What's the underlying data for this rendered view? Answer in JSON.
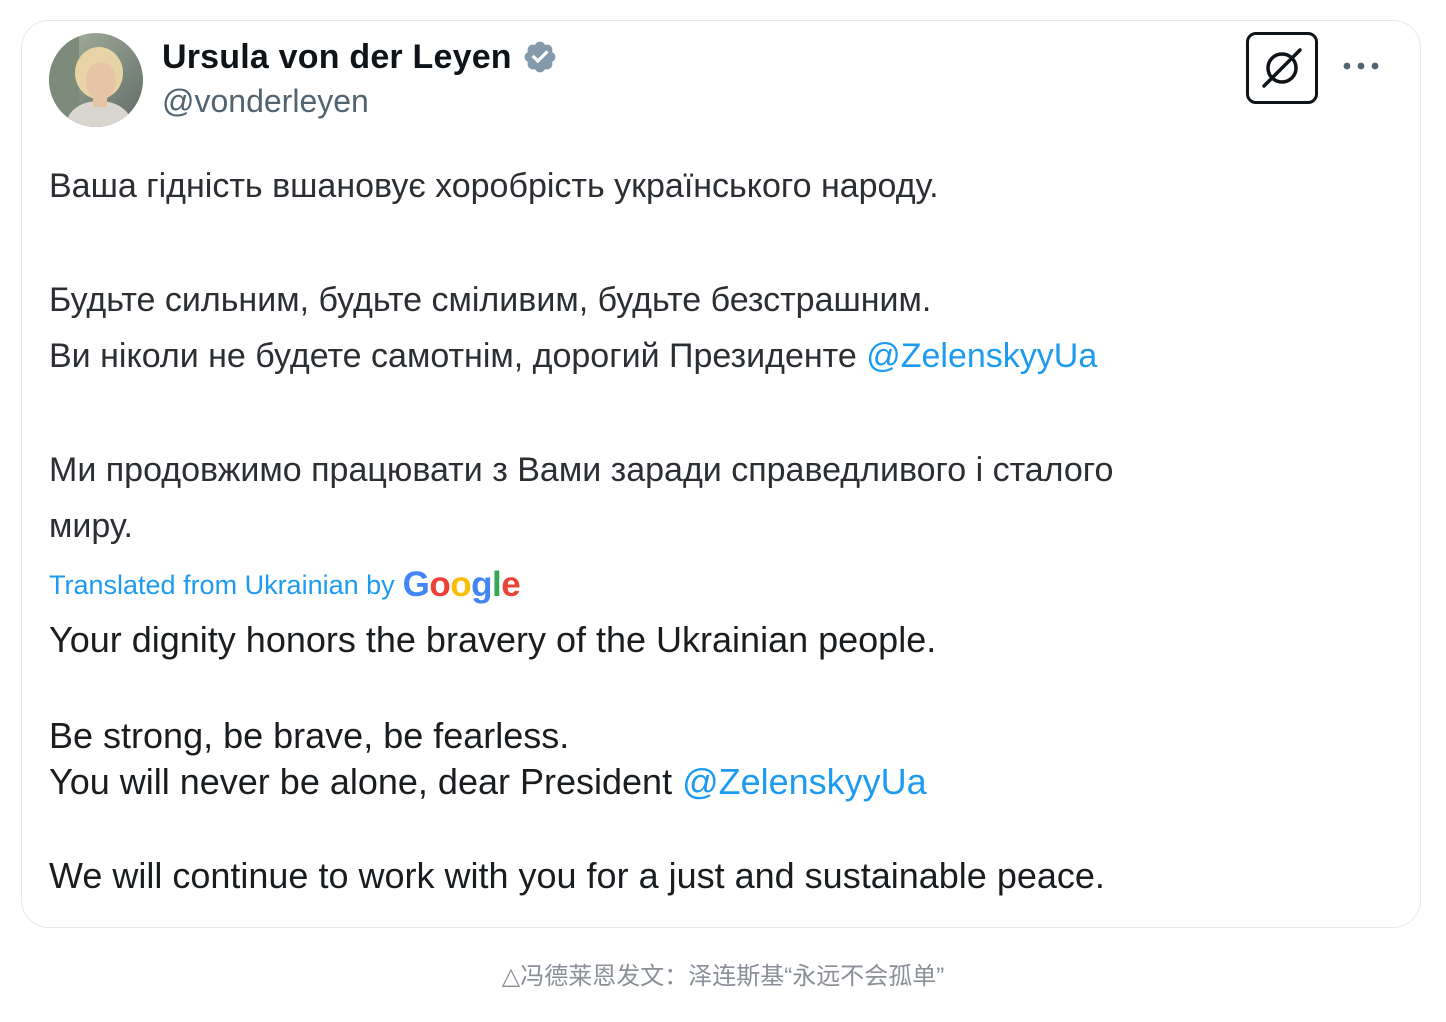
{
  "tweet": {
    "author_name": "Ursula von der Leyen",
    "author_handle": "@vonderleyen",
    "verified_icon": "verified-badge-icon",
    "grok_icon": "grok-icon",
    "more_icon": "more-dots-icon",
    "original": {
      "line1": "Ваша гідність вшановує хоробрість українського народу.",
      "line2": "Будьте сильним, будьте сміливим, будьте безстрашним.",
      "line3_text": "Ви ніколи не будете самотнім, дорогий Президенте ",
      "line3_mention": "@ZelenskyyUa",
      "line4": "Ми продовжимо працювати з Вами заради справедливого і сталого",
      "line5": "миру."
    },
    "translation_label": "Translated from Ukrainian by",
    "translation_provider": "Google",
    "translated": {
      "line1": "Your dignity honors the bravery of the Ukrainian people.",
      "line2": "Be strong, be brave, be fearless.",
      "line3_text": "You will never be alone, dear President ",
      "line3_mention": "@ZelenskyyUa",
      "line4": "We will continue to work with you for a just and sustainable peace."
    }
  },
  "caption": "△冯德莱恩发文：泽连斯基“永远不会孤单”",
  "colors": {
    "mention": "#1d9bf0",
    "verified": "#829aab",
    "text_primary": "#0f1419",
    "text_secondary": "#536471"
  }
}
